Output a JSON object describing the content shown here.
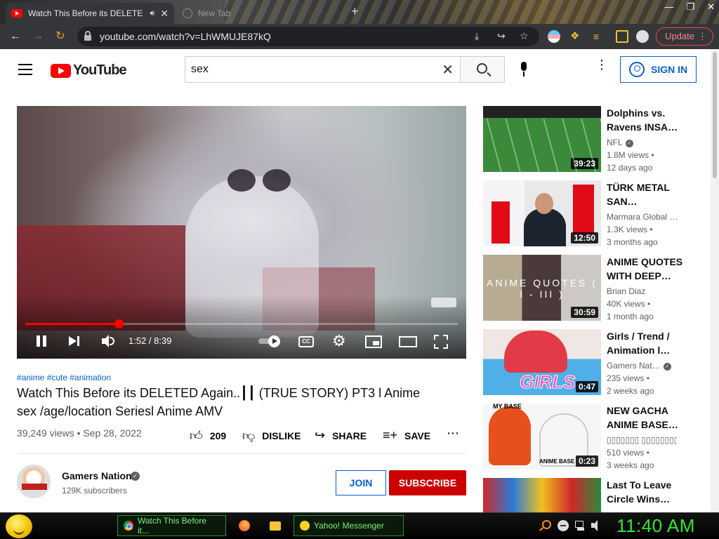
{
  "browser": {
    "tabs": [
      {
        "title": "Watch This Before its DELETE",
        "active": true,
        "favicon": "youtube-icon"
      },
      {
        "title": "New Tab",
        "active": false,
        "favicon": "globe-icon"
      }
    ],
    "url": "youtube.com/watch?v=LhWMUJE87kQ",
    "update_label": "Update",
    "accent": "#e84a3a"
  },
  "youtube": {
    "logo_text": "YouTube",
    "search": {
      "value": "sex",
      "placeholder": "Search"
    },
    "signin_label": "SIGN IN",
    "player": {
      "time_current": "1:52",
      "time_total": "8:39",
      "timecode": "1:52 / 8:39",
      "progress_fraction": 0.216,
      "progress_color": "#ff0000",
      "cc_label": "CC"
    },
    "video": {
      "hashtags": "#anime #cute #animation",
      "title": "Watch This Before its DELETED Again..┃┃ (TRUE STORY) PT3 l Anime sex /age/location Seriesl Anime AMV",
      "view_line": "39,249 views • Sep 28, 2022",
      "like_count": "209",
      "dislike_label": "DISLIKE",
      "share_label": "SHARE",
      "save_label": "SAVE"
    },
    "channel": {
      "name": "Gamers Nation",
      "subscribers": "129K subscribers",
      "join_label": "JOIN",
      "subscribe_label": "SUBSCRIBE"
    },
    "recommendations": [
      {
        "title": "Dolphins vs. Ravens INSA…",
        "channel": "NFL",
        "verified": true,
        "views": "1.8M views •",
        "age": "12 days ago",
        "duration": "39:23"
      },
      {
        "title": "TÜRK METAL SAN…",
        "channel": "Marmara Global …",
        "verified": false,
        "views": "1.3K views •",
        "age": "3 months ago",
        "duration": "12:50"
      },
      {
        "title": "ANIME QUOTES WITH DEEP…",
        "channel": "Brian Diaz",
        "verified": false,
        "views": "40K views •",
        "age": "1 month ago",
        "duration": "30:59",
        "thumb_text": "ANIME QUOTES ( I - III )"
      },
      {
        "title": "Girls / Trend / Animation l…",
        "channel": "Gamers Nat…",
        "verified": true,
        "views": "235 views •",
        "age": "2 weeks ago",
        "duration": "0:47",
        "thumb_text": "GIRLS"
      },
      {
        "title": "NEW GACHA ANIME BASE…",
        "channel": "▯▯▯▯▯▯▯ ▯▯▯▯▯▯▯▯…",
        "verified": false,
        "views": "510 views •",
        "age": "3 weeks ago",
        "duration": "0:23",
        "thumb_text_top": "MY BASE",
        "thumb_text_bottom": "ANIME BASE"
      },
      {
        "title": "Last To Leave Circle Wins…",
        "channel": "",
        "verified": false,
        "views": "",
        "age": "",
        "duration": ""
      }
    ]
  },
  "taskbar": {
    "tasks": [
      {
        "label": "Watch This Before it...",
        "icon": "chrome-icon"
      },
      {
        "label": "",
        "icon": "firefox-icon"
      },
      {
        "label": "",
        "icon": "folder-icon"
      },
      {
        "label": "Yahoo! Messenger",
        "icon": "yahoo-messenger-icon"
      }
    ],
    "clock": "11:40 AM",
    "clock_color": "#2ee82e"
  }
}
